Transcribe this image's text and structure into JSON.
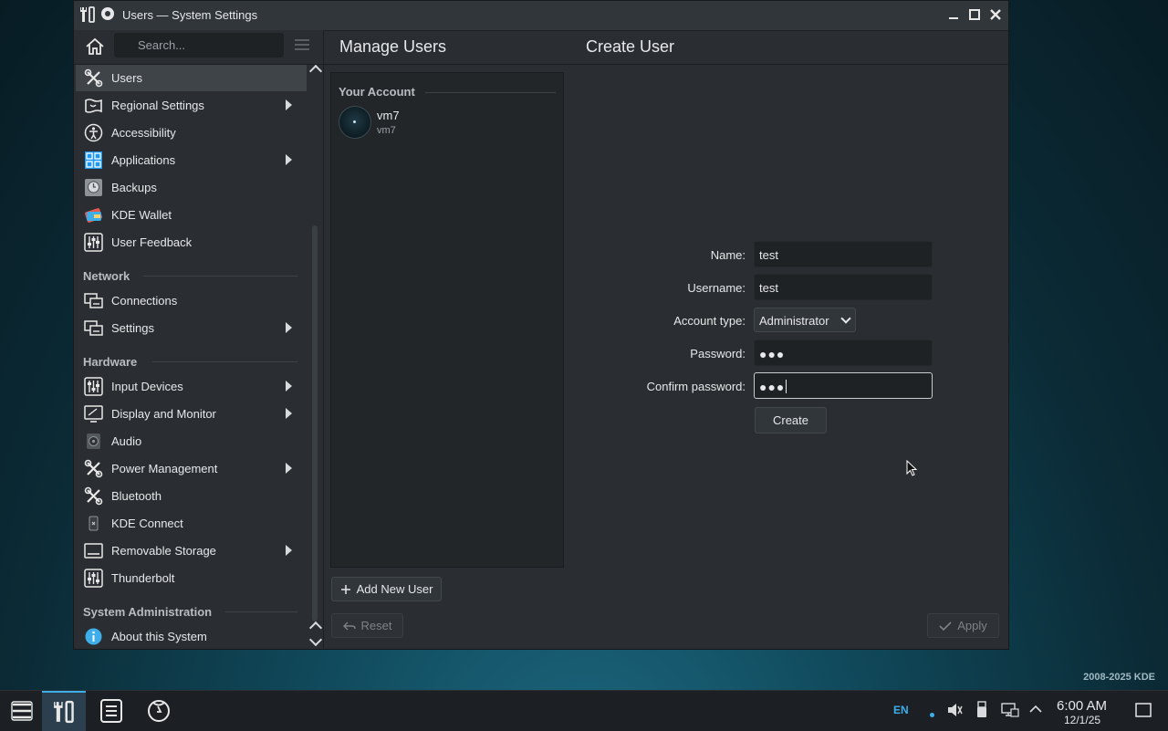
{
  "window": {
    "title": "Users — System Settings"
  },
  "sidebar": {
    "search_placeholder": "Search...",
    "items": [
      {
        "label": "Users",
        "icon": "tools-icon"
      },
      {
        "label": "Regional Settings",
        "icon": "regional-icon"
      },
      {
        "label": "Accessibility",
        "icon": "accessibility-icon"
      },
      {
        "label": "Applications",
        "icon": "applications-icon"
      },
      {
        "label": "Backups",
        "icon": "backups-icon"
      },
      {
        "label": "KDE Wallet",
        "icon": "wallet-icon"
      },
      {
        "label": "User Feedback",
        "icon": "feedback-icon"
      },
      {
        "label": "Connections",
        "icon": "network-icon"
      },
      {
        "label": "Settings",
        "icon": "network-settings-icon"
      },
      {
        "label": "Input Devices",
        "icon": "input-devices-icon"
      },
      {
        "label": "Display and Monitor",
        "icon": "display-icon"
      },
      {
        "label": "Audio",
        "icon": "audio-icon"
      },
      {
        "label": "Power Management",
        "icon": "power-icon"
      },
      {
        "label": "Bluetooth",
        "icon": "bluetooth-icon"
      },
      {
        "label": "KDE Connect",
        "icon": "kde-connect-icon"
      },
      {
        "label": "Removable Storage",
        "icon": "removable-storage-icon"
      },
      {
        "label": "Thunderbolt",
        "icon": "thunderbolt-icon"
      },
      {
        "label": "About this System",
        "icon": "info-icon"
      }
    ],
    "sections": {
      "network": "Network",
      "hardware": "Hardware",
      "system_administration": "System Administration"
    }
  },
  "main": {
    "manage_title": "Manage Users",
    "create_title": "Create User",
    "your_account_header": "Your Account",
    "account": {
      "name": "vm7",
      "username": "vm7"
    },
    "add_user_label": "Add New User",
    "reset_label": "Reset",
    "apply_label": "Apply"
  },
  "form": {
    "name_label": "Name:",
    "name_value": "test",
    "username_label": "Username:",
    "username_value": "test",
    "account_type_label": "Account type:",
    "account_type_value": "Administrator",
    "password_label": "Password:",
    "password_value": "●●●",
    "confirm_label": "Confirm password:",
    "confirm_value": "●●●",
    "create_label": "Create"
  },
  "taskbar": {
    "language": "EN",
    "time": "6:00 AM",
    "date": "12/1/25"
  },
  "desktop": {
    "brand": "2008-2025 KDE"
  },
  "colors": {
    "accent": "#3daee9",
    "window_bg": "#2a2e32",
    "selected": "#3f4449"
  }
}
